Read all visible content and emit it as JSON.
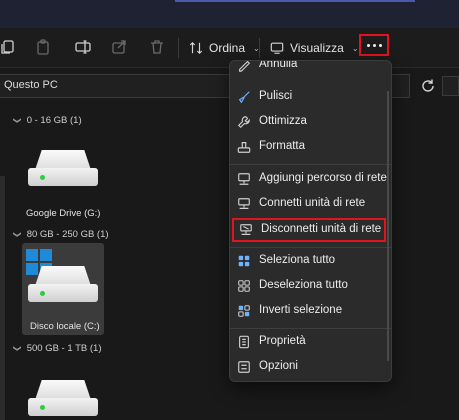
{
  "toolbar": {
    "sort_label": "Ordina",
    "view_label": "Visualizza",
    "icons": [
      "copy-icon",
      "paste-icon",
      "rename-icon",
      "share-icon",
      "delete-icon",
      "sort-icon",
      "view-icon",
      "more-icon"
    ]
  },
  "address": {
    "location": "Questo PC"
  },
  "groups": [
    {
      "label": "0 - 16 GB (1)",
      "drives": [
        {
          "label": "Google Drive (G:)"
        }
      ]
    },
    {
      "label": "80 GB - 250 GB (1)",
      "drives": [
        {
          "label": "Disco locale (C:)"
        }
      ]
    },
    {
      "label": "500 GB - 1 TB (1)",
      "drives": [
        {
          "label": ""
        }
      ]
    }
  ],
  "menu": {
    "top_item": "Annulla",
    "items": [
      {
        "label": "Pulisci",
        "icon": "broom-icon"
      },
      {
        "label": "Ottimizza",
        "icon": "wrench-icon"
      },
      {
        "label": "Formatta",
        "icon": "format-icon"
      },
      {
        "label": "Aggiungi percorso di rete",
        "icon": "network-location-icon"
      },
      {
        "label": "Connetti unità di rete",
        "icon": "map-drive-icon"
      },
      {
        "label": "Disconnetti unità di rete",
        "icon": "disconnect-drive-icon"
      },
      {
        "label": "Seleziona tutto",
        "icon": "select-all-icon"
      },
      {
        "label": "Deseleziona tutto",
        "icon": "select-none-icon"
      },
      {
        "label": "Inverti selezione",
        "icon": "invert-selection-icon"
      },
      {
        "label": "Proprietà",
        "icon": "properties-icon"
      },
      {
        "label": "Opzioni",
        "icon": "options-icon"
      }
    ]
  },
  "colors": {
    "highlight": "#e0141e",
    "led": "#2ecc40",
    "menu_bg": "#2b2b2b",
    "app_bg": "#191919"
  }
}
